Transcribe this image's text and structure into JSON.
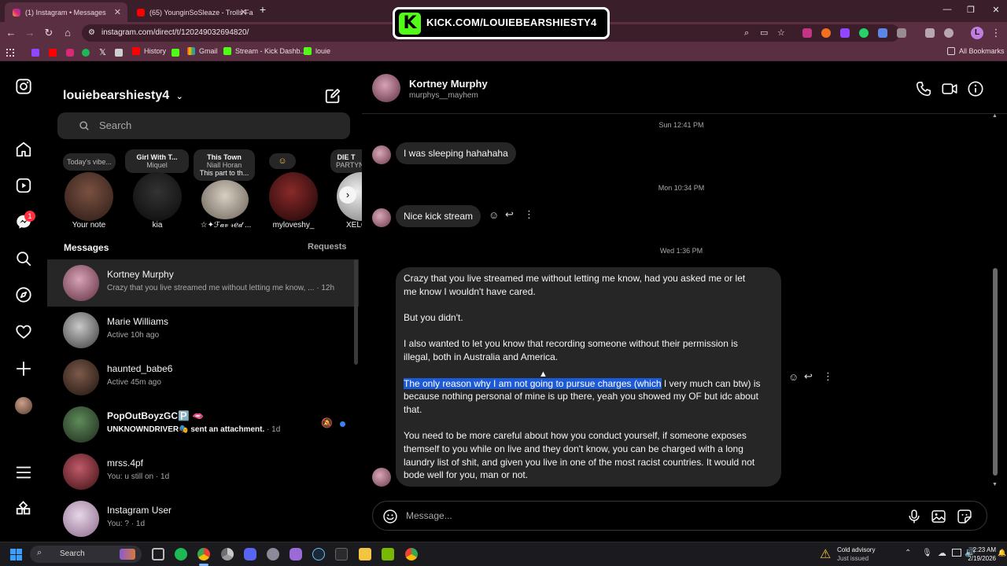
{
  "browser": {
    "tabs": [
      {
        "title": "(1) Instagram • Messages",
        "active": true
      },
      {
        "title": "(65) YounginSoSleaze - Trolls Fa",
        "active": false
      }
    ],
    "new_tab": "+",
    "url": "instagram.com/direct/t/120249032694820/",
    "bookmarks": [
      "History",
      "Gmail",
      "Stream - Kick Dashb...",
      "louie"
    ],
    "all_bookmarks": "All Bookmarks",
    "profile_letter": "L"
  },
  "overlay": {
    "text": "KICK.COM/LOUIEBEARSHIESTY4",
    "logo": "K"
  },
  "rail": {
    "badge": "1"
  },
  "panel": {
    "username": "louiebearshiesty4",
    "search_placeholder": "Search",
    "notes": [
      {
        "note": "Today's vibe...",
        "name": "Your note"
      },
      {
        "note_title": "Girl With T...",
        "note_sub": "Miquel",
        "name": "kia"
      },
      {
        "note_title": "This Town",
        "note_sub": "Niall Horan",
        "note_sub2": "This part to th...",
        "name": "☆✦ℱ𝒶𝓋 𝓇ℯ𝒹 ..."
      },
      {
        "note": "☺",
        "name": "myloveshy_"
      },
      {
        "note_title": "DIE T",
        "note_sub": "PARTYN",
        "name": "XELC"
      }
    ],
    "messages_header": "Messages",
    "requests_label": "Requests",
    "conversations": [
      {
        "name": "Kortney Murphy",
        "preview": "Crazy that you live streamed me without letting me know, ...",
        "time": "· 12h"
      },
      {
        "name": "Marie Williams",
        "preview": "Active 10h ago"
      },
      {
        "name": "haunted_babe6",
        "preview": "Active 45m ago"
      },
      {
        "name": "PopOutBoyzGC🅿️ 🫦",
        "preview_bold": "UNKNOWNDRIVER🎭 sent an attachment.",
        "time": "· 1d"
      },
      {
        "name": "mrss.4pf",
        "preview": "You: u still on",
        "time": "· 1d"
      },
      {
        "name": "Instagram User",
        "preview": "You: ?",
        "time": "· 1d"
      }
    ]
  },
  "chat": {
    "contact_name": "Kortney Murphy",
    "contact_handle": "murphys__mayhem",
    "timestamps": [
      "Sun 12:41 PM",
      "Mon 10:34 PM",
      "Wed 1:36 PM"
    ],
    "msg1": "I was sleeping hahahaha",
    "msg2": "Nice kick stream",
    "long_p1_l1": "Crazy that you live streamed me without letting me know, had you asked me or let",
    "long_p1_l2": "me know I wouldn't have cared.",
    "long_p2": "But you didn't.",
    "long_p3_l1": "I also wanted to let you know that recording someone without their permission is",
    "long_p3_l2": "illegal, both in Australia and America.",
    "long_p4_hl": "The only reason why I am not going to pursue charges (which",
    "long_p4_rest": " I very much can btw) is",
    "long_p4_l2": "because nothing personal of mine is up there, yeah you showed my OF but idc about",
    "long_p4_l3": "that.",
    "long_p5_l1": "You need to be more careful about how you conduct yourself, if someone exposes",
    "long_p5_l2": "themself to you while on live and they don't know, you can be charged with a long",
    "long_p5_l3": "laundry list of shit, and given you live in one of the most racist countries. It would not",
    "long_p5_l4": "bode well for you, man or not.",
    "composer_placeholder": "Message..."
  },
  "taskbar": {
    "search": "Search",
    "weather_title": "Cold advisory",
    "weather_sub": "Just issued",
    "time": "2:23 AM",
    "date": "2/19/2026"
  },
  "colors": {
    "accent_blue": "#1d5bd6",
    "kick_green": "#53fc18",
    "notif_red": "#ff3040",
    "unread_dot": "#3b82f6"
  }
}
